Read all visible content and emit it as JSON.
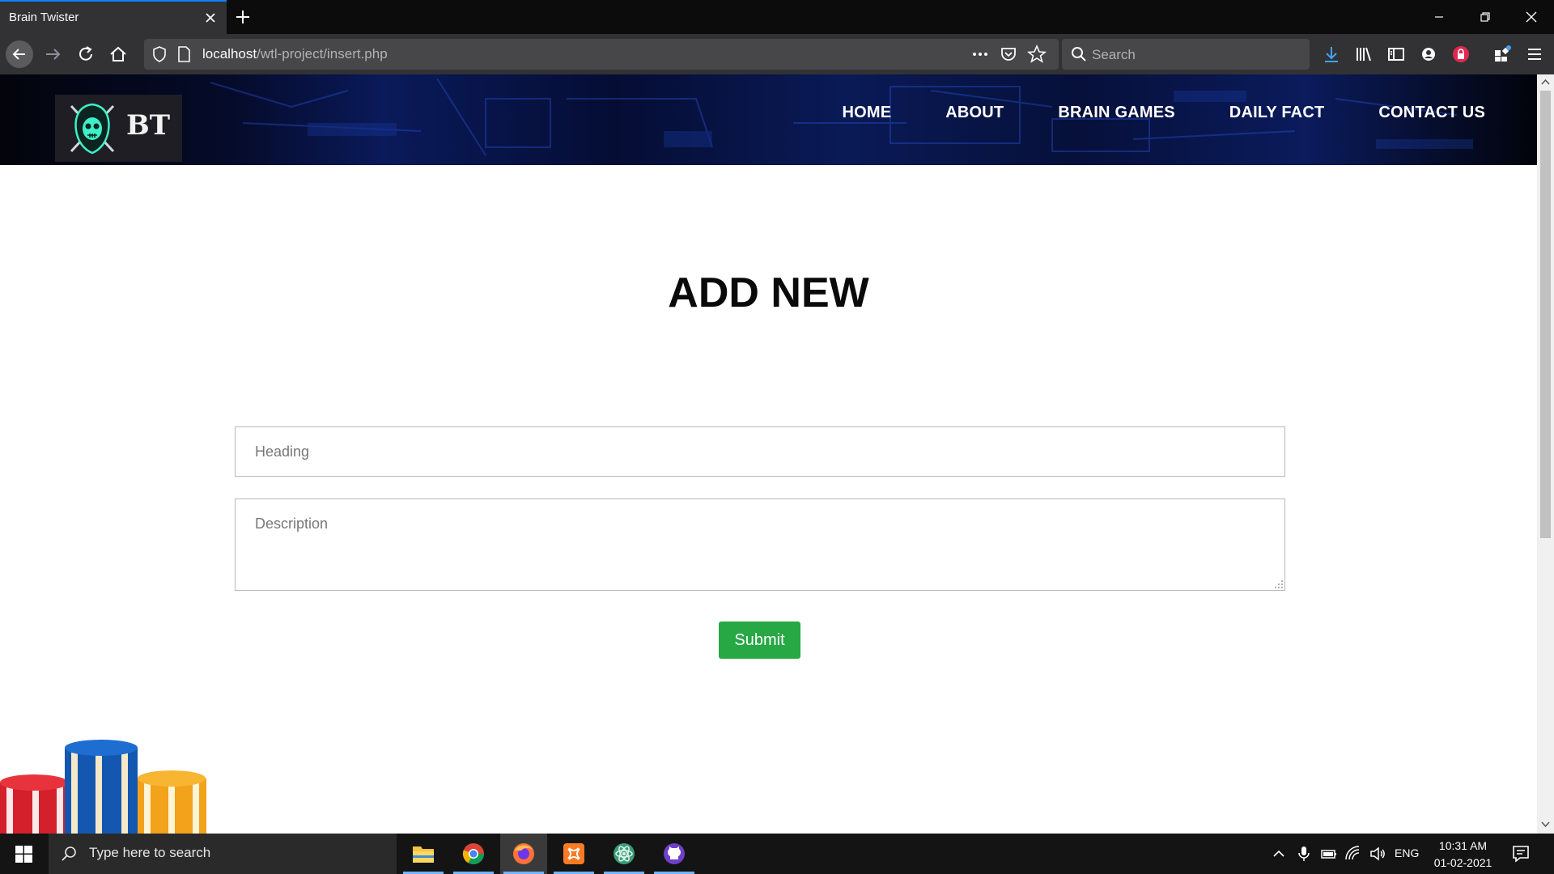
{
  "browser": {
    "tab_title": "Brain Twister",
    "url_host": "localhost",
    "url_path": "/wtl-project/insert.php",
    "search_placeholder": "Search",
    "accent": "#0a84ff"
  },
  "site": {
    "logo_text": "BT",
    "nav": [
      {
        "label": "HOME"
      },
      {
        "label": "ABOUT"
      },
      {
        "label": "BRAIN GAMES"
      },
      {
        "label": "DAILY FACT"
      },
      {
        "label": "CONTACT US"
      }
    ]
  },
  "form": {
    "title": "ADD NEW",
    "heading_placeholder": "Heading",
    "heading_value": "",
    "description_placeholder": "Description",
    "description_value": "",
    "submit_label": "Submit",
    "submit_color": "#28a745"
  },
  "taskbar": {
    "search_placeholder": "Type here to search",
    "apps": [
      "file-explorer-icon",
      "chrome-icon",
      "firefox-icon",
      "xampp-icon",
      "atom-icon",
      "github-desktop-icon"
    ],
    "language": "ENG",
    "time": "10:31 AM",
    "date": "01-02-2021"
  }
}
